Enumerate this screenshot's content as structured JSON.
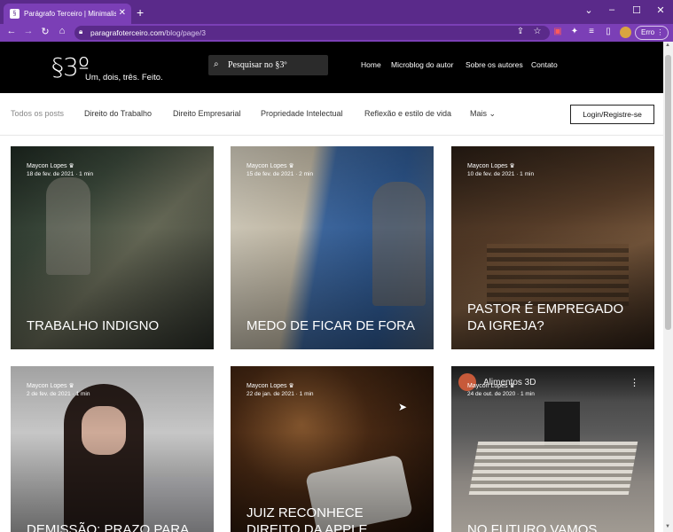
{
  "browser": {
    "tab_title": "Parágrafo Terceiro | Minimalismo",
    "url_host": "paragrafoterceiro.com",
    "url_path": "/blog/page/3",
    "profile_button": "Erro"
  },
  "header": {
    "logo_mark": "§3º",
    "tagline": "Um, dois, três. Feito.",
    "search_placeholder": "Pesquisar no §3º",
    "nav": [
      "Home",
      "Microblog do autor",
      "Sobre os autores",
      "Contato"
    ]
  },
  "categories": {
    "items": [
      "Todos os posts",
      "Direito do Trabalho",
      "Direito Empresarial",
      "Propriedade Intelectual",
      "Reflexão e estilo de vida",
      "Mais"
    ],
    "login": "Login/Registre-se"
  },
  "posts": [
    {
      "author": "Maycon Lopes",
      "date": "18 de fev. de 2021",
      "read": "1 min",
      "title": "TRABALHO INDIGNO"
    },
    {
      "author": "Maycon Lopes",
      "date": "15 de fev. de 2021",
      "read": "2 min",
      "title": "MEDO DE FICAR DE FORA"
    },
    {
      "author": "Maycon Lopes",
      "date": "10 de fev. de 2021",
      "read": "1 min",
      "title": "PASTOR É EMPREGADO DA IGREJA?"
    },
    {
      "author": "Maycon Lopes",
      "date": "2 de fev. de 2021",
      "read": "1 min",
      "title": "DEMISSÃO: PRAZO PARA"
    },
    {
      "author": "Maycon Lopes",
      "date": "22 de jan. de 2021",
      "read": "1 min",
      "title": "JUIZ RECONHECE DIREITO DA APPLE VENDER"
    },
    {
      "author": "Maycon Lopes",
      "date": "24 de out. de 2020",
      "read": "1 min",
      "title": "NO FUTURO VAMOS",
      "video_channel": "Alimentos 3D"
    }
  ],
  "meta_separator": "·",
  "colors": {
    "browser_frame": "#5a2a8a",
    "browser_tab": "#7b3fb6",
    "site_header": "#000000"
  }
}
